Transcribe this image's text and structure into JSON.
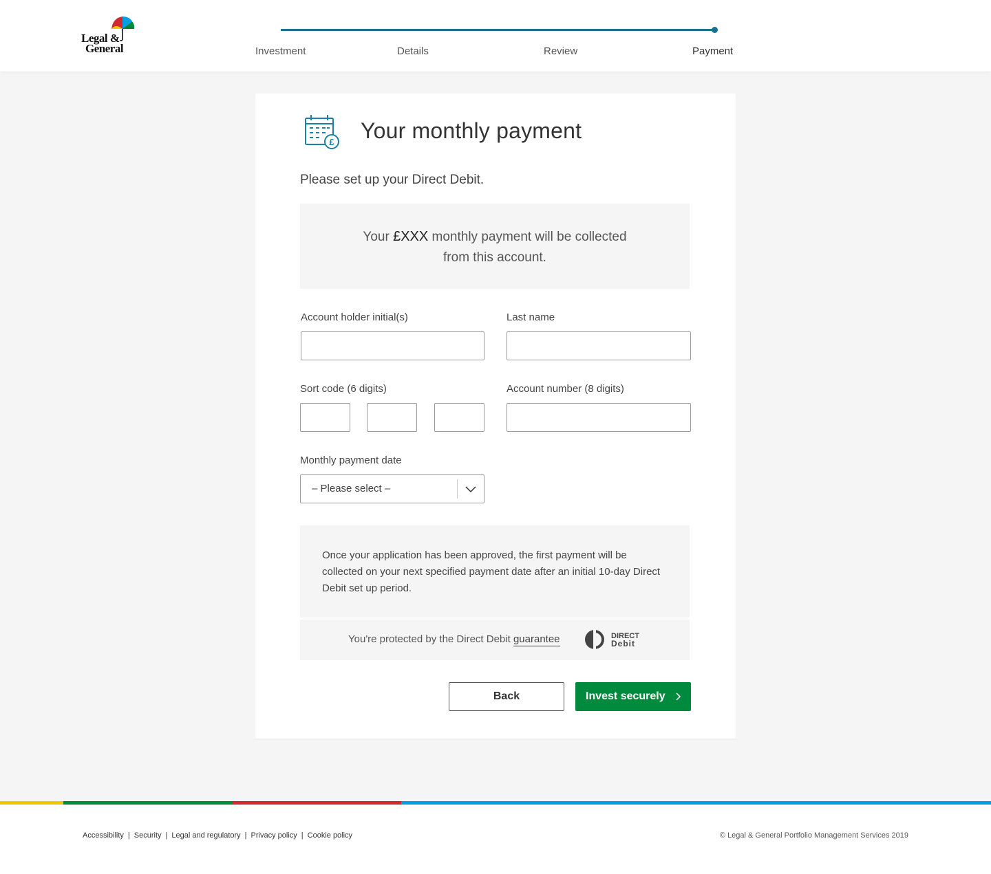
{
  "brand": {
    "logo_line1": "Legal &",
    "logo_line2": "General",
    "colors": {
      "teal": "#1b6f8f",
      "green": "#008a3e",
      "yellow": "#f2c500",
      "red": "#d02a31",
      "blue": "#009fe3"
    }
  },
  "progress": {
    "steps": [
      "Investment",
      "Details",
      "Review",
      "Payment"
    ],
    "current_step": "Payment"
  },
  "card": {
    "title": "Your monthly payment",
    "icon": "calendar-pound-icon",
    "intro": "Please set up your Direct Debit.",
    "info_prefix": "Your",
    "info_amount": "£XXX",
    "info_suffix_line1": "monthly payment will be collected",
    "info_line2": "from this account."
  },
  "form": {
    "initials_label": "Account holder initial(s)",
    "initials_value": "",
    "last_name_label": "Last name",
    "last_name_value": "",
    "sort_code_label": "Sort code (6 digits)",
    "sort_code_values": [
      "",
      "",
      ""
    ],
    "account_number_label": "Account number (8 digits)",
    "account_number_value": "",
    "payment_date_label": "Monthly payment date",
    "payment_date_selected": "– Please select –"
  },
  "note": {
    "text": "Once your application has been approved, the first payment will be collected on your next specified payment date after an initial 10-day Direct Debit set up period.",
    "guarantee_prefix": "You're protected by the Direct Debit",
    "guarantee_link": "guarantee",
    "dd_logo_line1": "DIRECT",
    "dd_logo_line2": "Debit"
  },
  "actions": {
    "back_label": "Back",
    "invest_label": "Invest securely"
  },
  "footer": {
    "links": [
      "Accessibility",
      "Security",
      "Legal and regulatory",
      "Privacy policy",
      "Cookie policy"
    ],
    "separator": "|",
    "copyright": "© Legal & General Portfolio Management Services 2019"
  }
}
